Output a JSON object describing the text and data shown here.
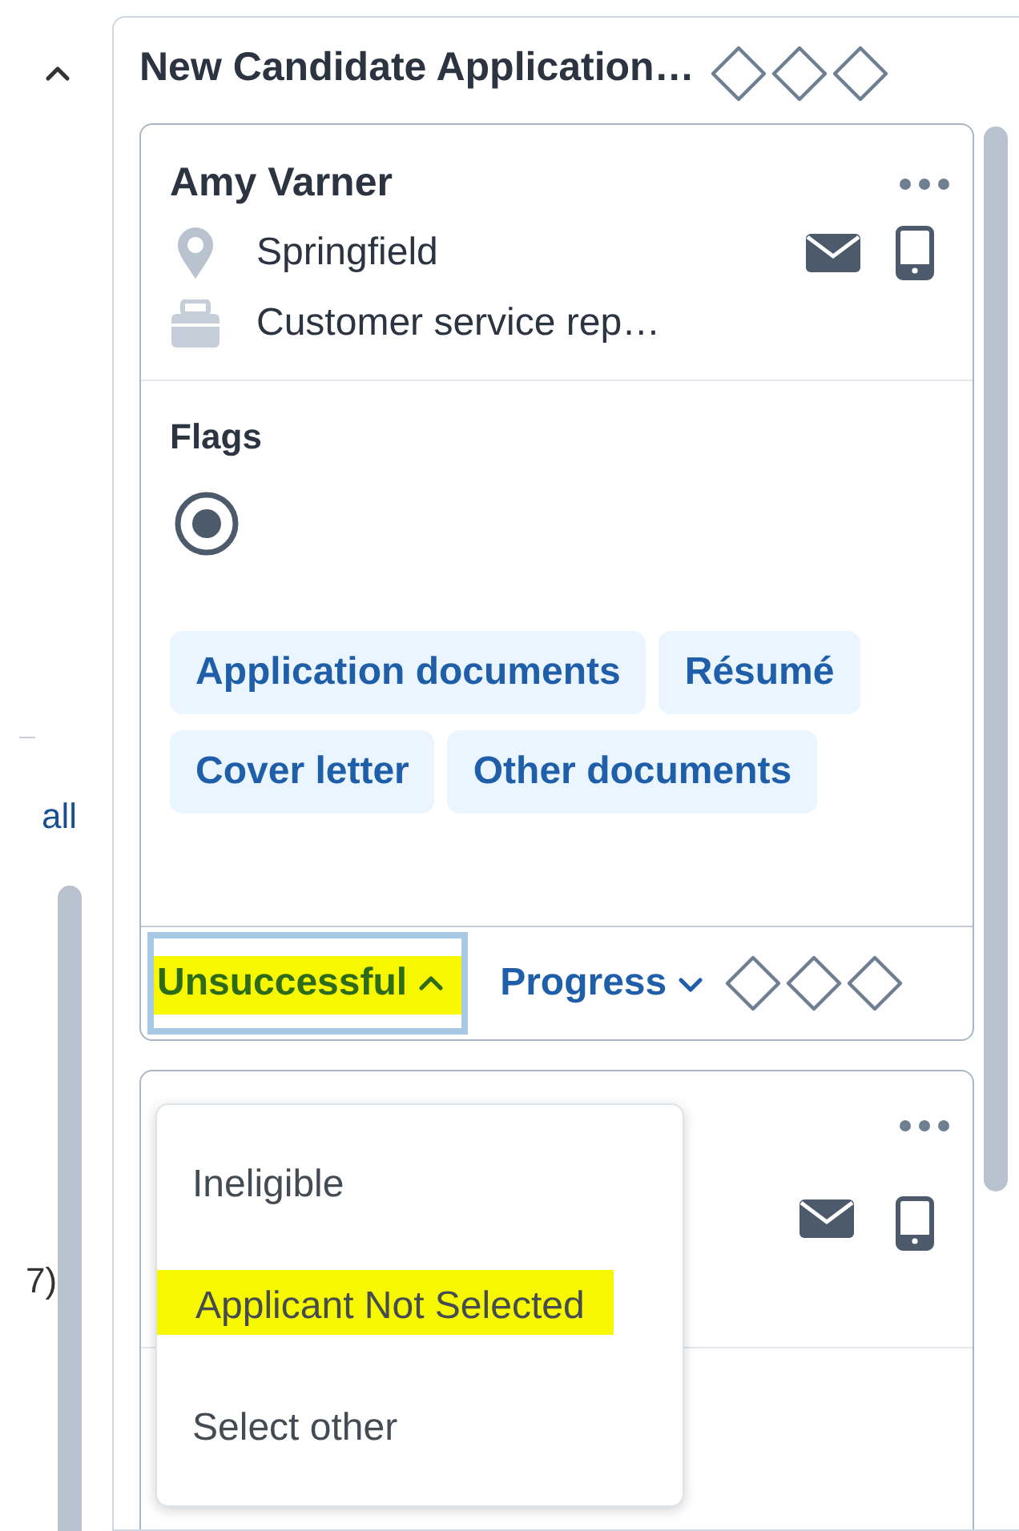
{
  "sidebar": {
    "texts": [
      "all",
      "7)"
    ]
  },
  "column": {
    "title": "New Candidate Application…",
    "cards": [
      {
        "name": "Amy Varner",
        "location": "Springfield",
        "job": "Customer service rep…",
        "flags_label": "Flags",
        "flag_selected": true,
        "documents": [
          "Application documents",
          "Résumé",
          "Cover letter",
          "Other documents"
        ],
        "status": {
          "label": "Unsuccessful",
          "expanded": true,
          "highlighted": true
        },
        "progress": {
          "label": "Progress",
          "expanded": false
        }
      }
    ]
  },
  "status_menu": {
    "options": [
      {
        "label": "Ineligible",
        "highlighted": false
      },
      {
        "label": "Applicant Not Selected",
        "highlighted": true
      },
      {
        "label": "Select other",
        "highlighted": false
      }
    ]
  }
}
